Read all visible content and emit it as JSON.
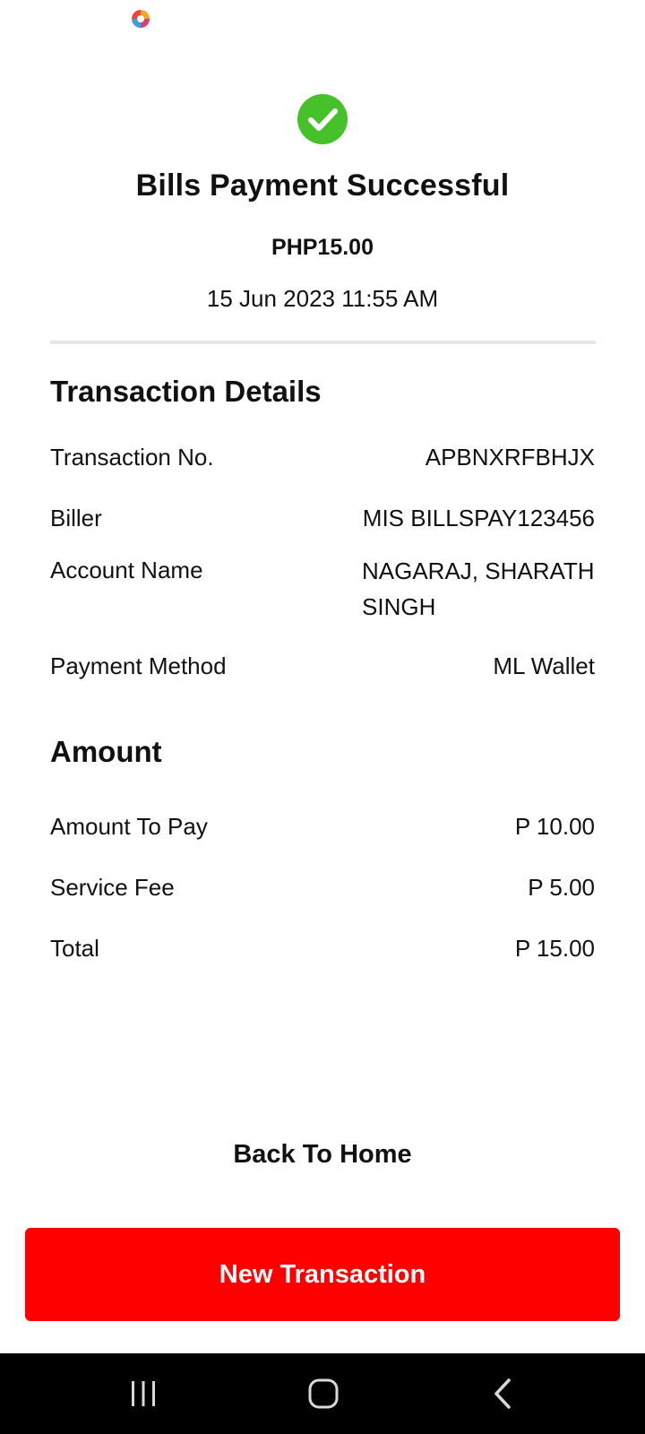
{
  "status_bar": {
    "app_icon": "app-logo-icon"
  },
  "header": {
    "icon": "check-circle-icon",
    "title": "Bills Payment Successful",
    "amount": "PHP15.00",
    "datetime": "15 Jun 2023 11:55 AM"
  },
  "transaction_details": {
    "title": "Transaction Details",
    "rows": [
      {
        "label": "Transaction No.",
        "value": "APBNXRFBHJX"
      },
      {
        "label": "Biller",
        "value": "MIS BILLSPAY123456"
      },
      {
        "label": "Account Name",
        "value": "NAGARAJ, SHARATH SINGH"
      },
      {
        "label": "Payment Method",
        "value": "ML Wallet"
      }
    ]
  },
  "amount": {
    "title": "Amount",
    "rows": [
      {
        "label": "Amount To Pay",
        "value": "P 10.00"
      },
      {
        "label": "Service Fee",
        "value": "P 5.00"
      },
      {
        "label": "Total",
        "value": "P 15.00"
      }
    ]
  },
  "actions": {
    "back_home_label": "Back To Home",
    "new_transaction_label": "New Transaction"
  },
  "nav_bar": {
    "recent": "recent-apps-icon",
    "home": "home-icon",
    "back": "back-icon"
  },
  "colors": {
    "primary_button": "#ff0000",
    "success": "#47c12a",
    "divider": "#e6e6e6"
  }
}
